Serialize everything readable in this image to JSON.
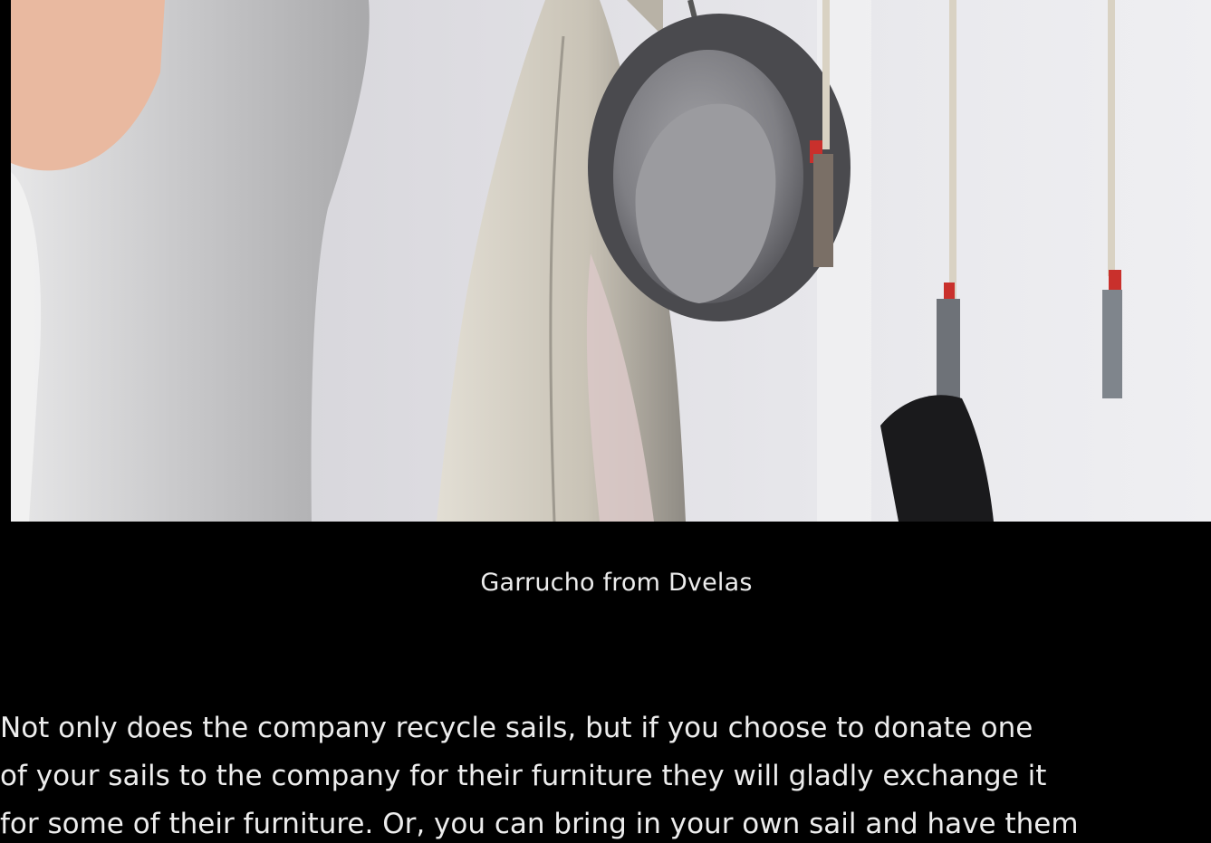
{
  "figure": {
    "image_alt": "Garrucho from Dvelas",
    "caption": "Garrucho from Dvelas"
  },
  "article": {
    "lines": [
      "Not only does the company recycle sails, but if you choose to donate one",
      "of your sails to the company for their furniture they will gladly exchange it",
      "for some of their furniture. Or, you can bring in your own sail and have them"
    ]
  },
  "colors": {
    "page_background": "#000000",
    "text": "#ededed"
  }
}
